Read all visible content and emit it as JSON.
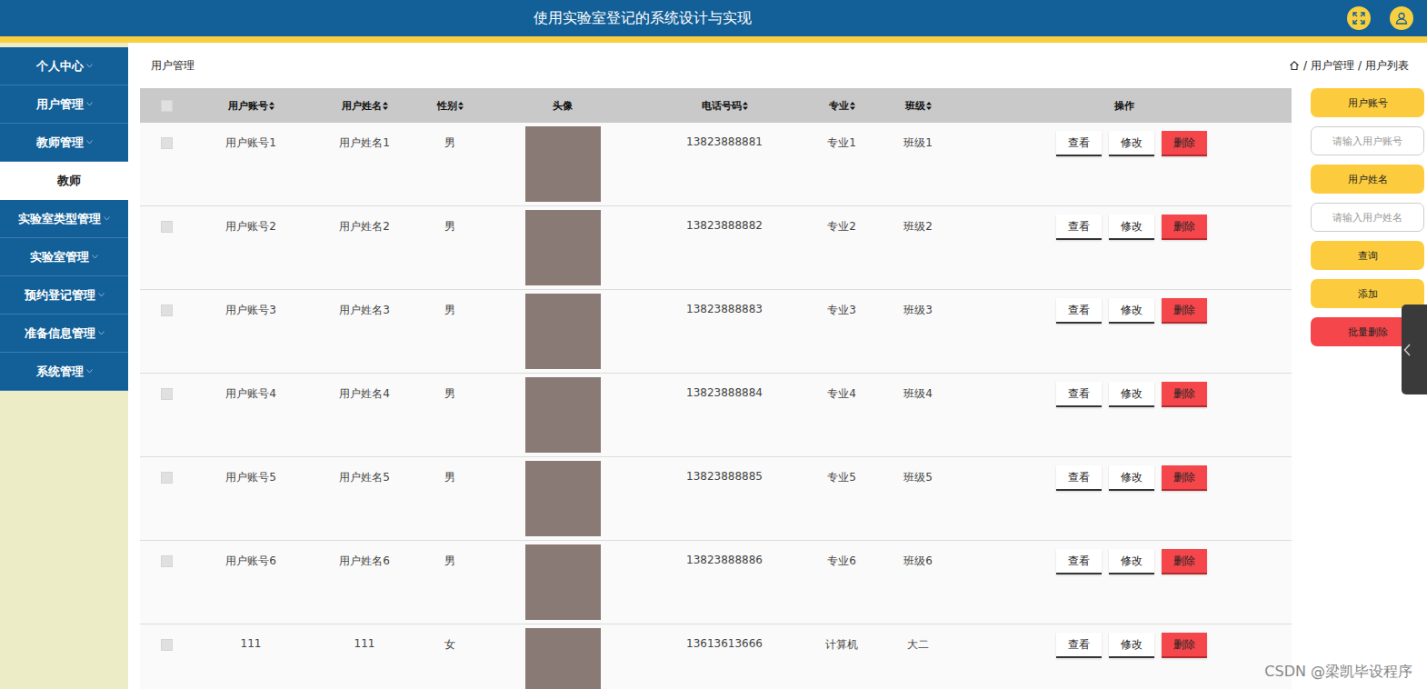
{
  "header": {
    "title": "使用实验室登记的系统设计与实现"
  },
  "sidebar": {
    "items": [
      {
        "label": "个人中心",
        "expanded": false,
        "children": []
      },
      {
        "label": "用户管理",
        "expanded": false,
        "children": []
      },
      {
        "label": "教师管理",
        "expanded": true,
        "children": [
          {
            "label": "教师",
            "selected": false
          }
        ]
      },
      {
        "label": "实验室类型管理",
        "expanded": false,
        "children": []
      },
      {
        "label": "实验室管理",
        "expanded": false,
        "children": []
      },
      {
        "label": "预约登记管理",
        "expanded": false,
        "children": []
      },
      {
        "label": "准备信息管理",
        "expanded": false,
        "children": []
      },
      {
        "label": "系统管理",
        "expanded": false,
        "children": []
      }
    ]
  },
  "breadcrumb": {
    "title": "用户管理",
    "separator": "/",
    "path": [
      "用户管理",
      "用户列表"
    ]
  },
  "table": {
    "header_checked": false,
    "columns": [
      {
        "label": "用户账号",
        "sortable": true
      },
      {
        "label": "用户姓名",
        "sortable": true
      },
      {
        "label": "性别",
        "sortable": true
      },
      {
        "label": "头像",
        "sortable": false
      },
      {
        "label": "电话号码",
        "sortable": true
      },
      {
        "label": "专业",
        "sortable": true
      },
      {
        "label": "班级",
        "sortable": true
      },
      {
        "label": "操作",
        "sortable": false
      }
    ],
    "actions": [
      {
        "label": "查看",
        "kind": "plain"
      },
      {
        "label": "修改",
        "kind": "plain"
      },
      {
        "label": "删除",
        "kind": "danger"
      }
    ],
    "rows": [
      {
        "checked": false,
        "account": "用户账号1",
        "name": "用户姓名1",
        "gender": "男",
        "phone": "13823888881",
        "major": "专业1",
        "class": "班级1"
      },
      {
        "checked": false,
        "account": "用户账号2",
        "name": "用户姓名2",
        "gender": "男",
        "phone": "13823888882",
        "major": "专业2",
        "class": "班级2"
      },
      {
        "checked": false,
        "account": "用户账号3",
        "name": "用户姓名3",
        "gender": "男",
        "phone": "13823888883",
        "major": "专业3",
        "class": "班级3"
      },
      {
        "checked": false,
        "account": "用户账号4",
        "name": "用户姓名4",
        "gender": "男",
        "phone": "13823888884",
        "major": "专业4",
        "class": "班级4"
      },
      {
        "checked": false,
        "account": "用户账号5",
        "name": "用户姓名5",
        "gender": "男",
        "phone": "13823888885",
        "major": "专业5",
        "class": "班级5"
      },
      {
        "checked": false,
        "account": "用户账号6",
        "name": "用户姓名6",
        "gender": "男",
        "phone": "13823888886",
        "major": "专业6",
        "class": "班级6"
      },
      {
        "checked": false,
        "account": "111",
        "name": "111",
        "gender": "女",
        "phone": "13613613666",
        "major": "计算机",
        "class": "大二"
      }
    ]
  },
  "search_panel": [
    {
      "kind": "label",
      "text": "用户账号"
    },
    {
      "kind": "input",
      "placeholder": "请输入用户账号"
    },
    {
      "kind": "label",
      "text": "用户姓名"
    },
    {
      "kind": "input",
      "placeholder": "请输入用户姓名"
    },
    {
      "kind": "button",
      "text": "查询"
    },
    {
      "kind": "button",
      "text": "添加"
    },
    {
      "kind": "danger",
      "text": "批量删除"
    }
  ],
  "watermark": "CSDN @梁凯毕设程序"
}
